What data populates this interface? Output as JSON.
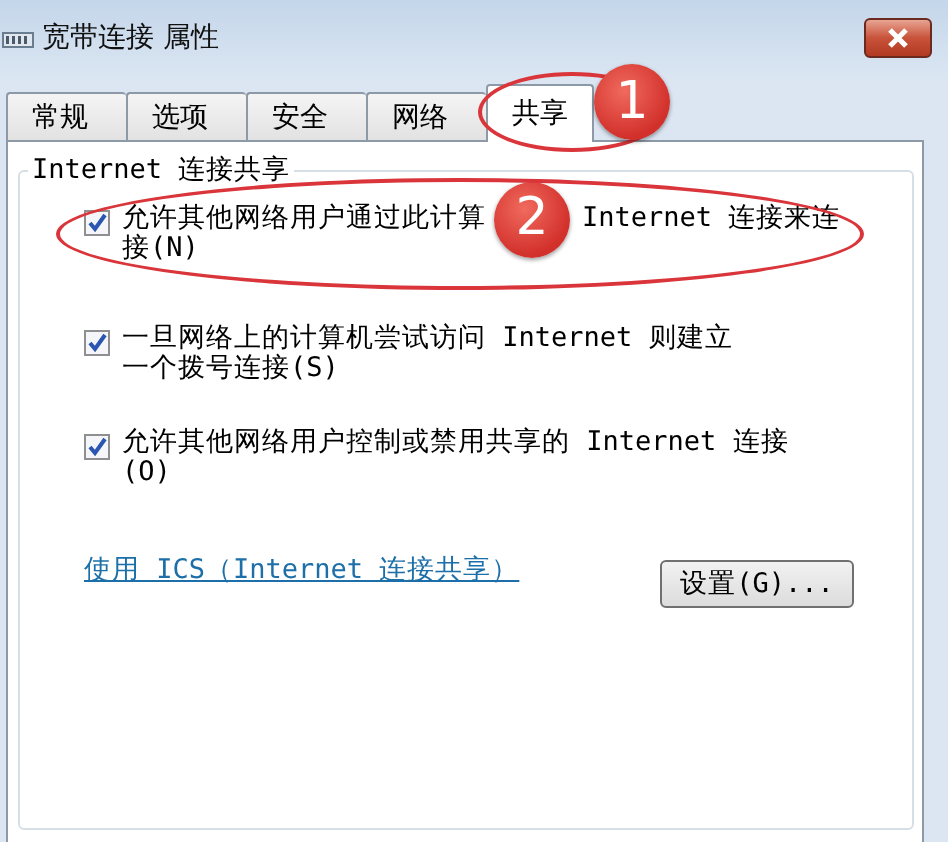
{
  "window": {
    "title": "宽带连接 属性"
  },
  "tabs": [
    {
      "label": "常规",
      "selected": false
    },
    {
      "label": "选项",
      "selected": false
    },
    {
      "label": "安全",
      "selected": false
    },
    {
      "label": "网络",
      "selected": false
    },
    {
      "label": "共享",
      "selected": true,
      "badge": "1"
    }
  ],
  "group": {
    "title": "Internet 连接共享",
    "options": [
      {
        "text_before": "允许其他网络用户通过此计算",
        "badge": "2",
        "text_after": "Internet 连接来连",
        "text_line2": "接(N)",
        "checked": true
      },
      {
        "label": "一旦网络上的计算机尝试访问 Internet 则建立一个拨号连接(S)",
        "checked": true
      },
      {
        "label": "允许其他网络用户控制或禁用共享的 Internet 连接(O)",
        "checked": true
      }
    ]
  },
  "link": "使用 ICS（Internet 连接共享）",
  "settings_button": "设置(G)..."
}
